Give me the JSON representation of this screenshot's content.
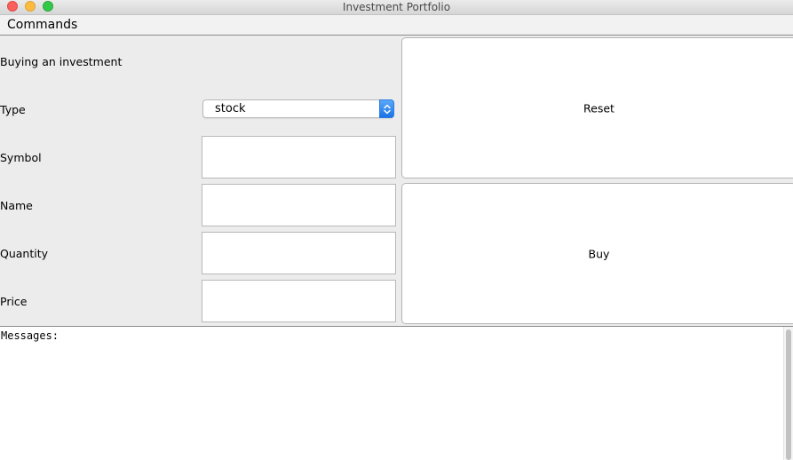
{
  "window": {
    "title": "Investment Portfolio"
  },
  "menubar": {
    "commands_label": "Commands"
  },
  "form": {
    "heading": "Buying an investment",
    "type_label": "Type",
    "type_value": "stock",
    "symbol_label": "Symbol",
    "symbol_value": "",
    "name_label": "Name",
    "name_value": "",
    "quantity_label": "Quantity",
    "quantity_value": "",
    "price_label": "Price",
    "price_value": ""
  },
  "actions": {
    "reset_label": "Reset",
    "buy_label": "Buy"
  },
  "messages": {
    "text": "Messages:"
  },
  "colors": {
    "close": "#fc605c",
    "minimize": "#fdbc40",
    "zoom": "#34c84a",
    "select_accent": "#1a73e8"
  },
  "icons": {
    "select_arrow": "chevron-up-down-icon"
  }
}
